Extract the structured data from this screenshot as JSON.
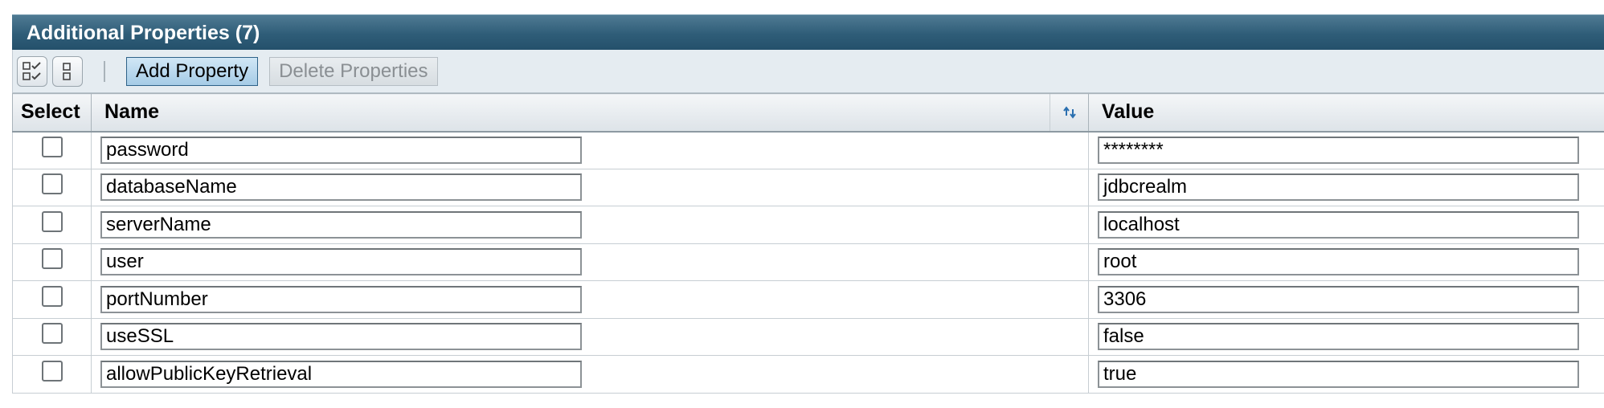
{
  "panel": {
    "title": "Additional Properties (7)"
  },
  "toolbar": {
    "select_all_icon": "select-all-icon",
    "deselect_all_icon": "deselect-all-icon",
    "add_label": "Add Property",
    "delete_label": "Delete Properties"
  },
  "table": {
    "headers": {
      "select": "Select",
      "name": "Name",
      "value": "Value"
    },
    "rows": [
      {
        "name": "password",
        "value": "********"
      },
      {
        "name": "databaseName",
        "value": "jdbcrealm"
      },
      {
        "name": "serverName",
        "value": "localhost"
      },
      {
        "name": "user",
        "value": "root"
      },
      {
        "name": "portNumber",
        "value": "3306"
      },
      {
        "name": "useSSL",
        "value": "false"
      },
      {
        "name": "allowPublicKeyRetrieval",
        "value": "true"
      }
    ]
  },
  "colors": {
    "titlebar": "#2f5d78",
    "toolbar_bg": "#e5ecf1",
    "primary_button": "#a5cbe6",
    "sort_arrow_blue": "#2a6fb0"
  }
}
